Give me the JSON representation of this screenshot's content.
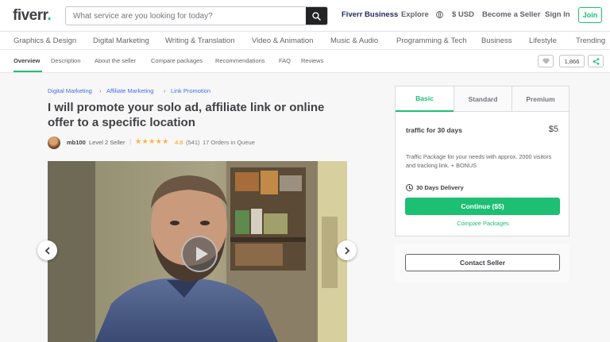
{
  "header": {
    "logo": "fiverr",
    "logo_dot": ".",
    "search_placeholder": "What service are you looking for today?",
    "nav": {
      "business": "Fiverr Business",
      "explore": "Explore",
      "currency": "$ USD",
      "become_seller": "Become a Seller",
      "sign_in": "Sign In",
      "join": "Join"
    }
  },
  "categories": [
    "Graphics & Design",
    "Digital Marketing",
    "Writing & Translation",
    "Video & Animation",
    "Music & Audio",
    "Programming & Tech",
    "Business",
    "Lifestyle",
    "Trending"
  ],
  "subnav": {
    "items": [
      "Overview",
      "Description",
      "About the seller",
      "Compare packages",
      "Recommendations",
      "FAQ",
      "Reviews"
    ],
    "active": "Overview",
    "likes": "1,866"
  },
  "breadcrumb": [
    "Digital Marketing",
    "Affiliate Marketing",
    "Link Promotion"
  ],
  "gig": {
    "title": "I will promote your solo ad, affiliate link or online offer to a specific location",
    "seller": "mb100",
    "level": "Level 2 Seller",
    "stars": "★★★★★",
    "rating": "4.8",
    "reviews": "(541)",
    "orders": "17 Orders in Queue"
  },
  "package": {
    "tabs": [
      "Basic",
      "Standard",
      "Premium"
    ],
    "active_tab": "Basic",
    "name": "traffic for 30 days",
    "price": "$5",
    "description": "Traffic Package for your needs with approx. 2000 visitors and tracking link. + BONUS",
    "delivery": "30 Days Delivery",
    "continue_label": "Continue ($5)",
    "compare_label": "Compare Packages",
    "contact_label": "Contact Seller"
  },
  "colors": {
    "brand_green": "#1dbf73",
    "link_blue": "#446ee7",
    "star_orange": "#ffb33e",
    "business_navy": "#1f2a5c"
  }
}
